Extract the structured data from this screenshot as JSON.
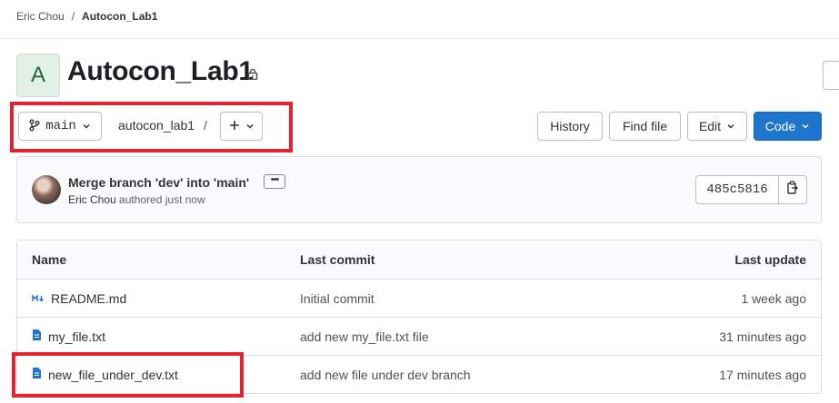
{
  "breadcrumb": {
    "group": "Eric Chou",
    "separator": "/",
    "project": "Autocon_Lab1"
  },
  "project": {
    "avatar_letter": "A",
    "title": "Autocon_Lab1"
  },
  "toolbar": {
    "branch": "main",
    "path_root": "autocon_lab1",
    "path_separator": "/",
    "history_label": "History",
    "find_file_label": "Find file",
    "edit_label": "Edit",
    "code_label": "Code"
  },
  "commit": {
    "title": "Merge branch 'dev' into 'main'",
    "ellipsis": "•••",
    "author": "Eric Chou",
    "authored_text": "authored just now",
    "sha": "485c5816"
  },
  "table": {
    "headers": {
      "name": "Name",
      "last_commit": "Last commit",
      "last_update": "Last update"
    },
    "rows": [
      {
        "name": "README.md",
        "commit": "Initial commit",
        "updated": "1 week ago",
        "icon": "markdown-icon"
      },
      {
        "name": "my_file.txt",
        "commit": "add new my_file.txt file",
        "updated": "31 minutes ago",
        "icon": "file-icon"
      },
      {
        "name": "new_file_under_dev.txt",
        "commit": "add new file under dev branch",
        "updated": "17 minutes ago",
        "icon": "file-icon"
      }
    ]
  },
  "colors": {
    "accent": "#1f75cb",
    "highlight": "#e5232f"
  }
}
